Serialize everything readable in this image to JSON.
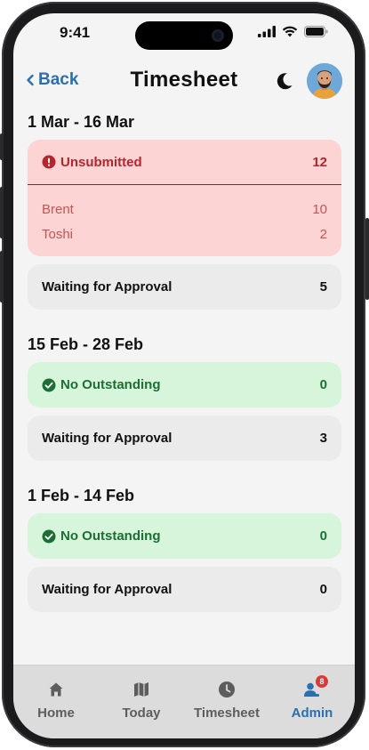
{
  "status_bar": {
    "time": "9:41"
  },
  "header": {
    "back_label": "Back",
    "title": "Timesheet"
  },
  "periods": [
    {
      "title": "1 Mar - 16 Mar",
      "status": {
        "label": "Unsubmitted",
        "count": "12",
        "kind": "unsubmitted"
      },
      "people": [
        {
          "name": "Brent",
          "count": "10"
        },
        {
          "name": "Toshi",
          "count": "2"
        }
      ],
      "waiting": {
        "label": "Waiting for Approval",
        "count": "5"
      }
    },
    {
      "title": "15 Feb - 28 Feb",
      "status": {
        "label": "No Outstanding",
        "count": "0",
        "kind": "ok"
      },
      "waiting": {
        "label": "Waiting for Approval",
        "count": "3"
      }
    },
    {
      "title": "1 Feb - 14 Feb",
      "status": {
        "label": "No Outstanding",
        "count": "0",
        "kind": "ok"
      },
      "waiting": {
        "label": "Waiting for Approval",
        "count": "0"
      }
    }
  ],
  "tabbar": {
    "tabs": [
      {
        "label": "Home",
        "icon": "home-icon"
      },
      {
        "label": "Today",
        "icon": "map-icon"
      },
      {
        "label": "Timesheet",
        "icon": "clock-icon"
      },
      {
        "label": "Admin",
        "icon": "admin-user-icon",
        "badge": "8",
        "active": true
      }
    ]
  },
  "colors": {
    "accent": "#2a6fb0",
    "unsubmitted_bg": "#fdd4d4",
    "unsubmitted_text": "#b3262d",
    "ok_bg": "#d6f5da",
    "ok_text": "#1d6e34",
    "neutral_bg": "#ebebeb",
    "badge": "#d63a3a"
  }
}
